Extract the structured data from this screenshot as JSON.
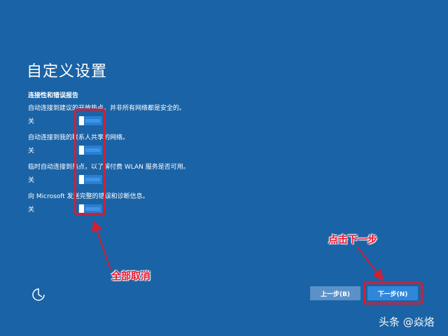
{
  "title": "自定义设置",
  "section_title": "连接性和错误报告",
  "settings": [
    {
      "desc": "自动连接到建议的开放热点，并非所有网络都是安全的。",
      "state": "关"
    },
    {
      "desc": "自动连接到我的联系人共享的网络。",
      "state": "关"
    },
    {
      "desc": "临时自动连接到热点，以了解付费 WLAN 服务是否可用。",
      "state": "关"
    },
    {
      "desc": "向 Microsoft 发送完整的错误和诊断信息。",
      "state": "关"
    }
  ],
  "annotations": {
    "cancel_all": "全部取消",
    "click_next": "点击下一步"
  },
  "buttons": {
    "back": "上一步(B)",
    "next": "下一步(N)"
  },
  "watermark": "头条 @焱烙",
  "colors": {
    "background": "#1a63a6",
    "annotation": "#e8152d",
    "toggle": "#2a7ed2"
  }
}
